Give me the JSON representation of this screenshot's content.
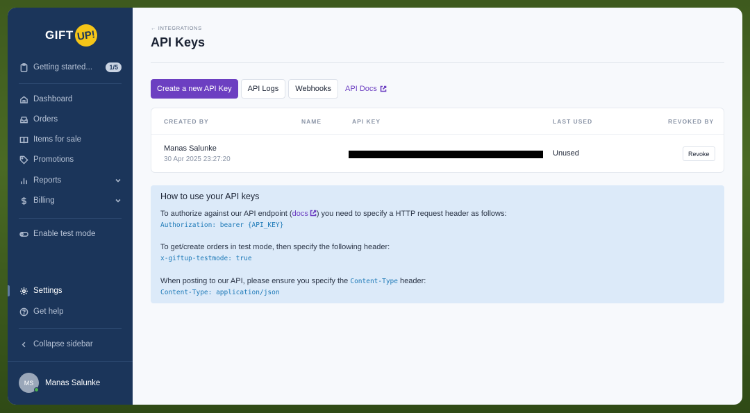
{
  "app": {
    "logo_text": "GIFT",
    "logo_badge": "UP!"
  },
  "sidebar": {
    "getting_started": {
      "label": "Getting started...",
      "badge": "1/5"
    },
    "items": [
      {
        "label": "Dashboard",
        "icon": "home-icon"
      },
      {
        "label": "Orders",
        "icon": "inbox-icon"
      },
      {
        "label": "Items for sale",
        "icon": "book-icon"
      },
      {
        "label": "Promotions",
        "icon": "tag-icon"
      },
      {
        "label": "Reports",
        "icon": "bar-chart-icon",
        "expandable": true
      },
      {
        "label": "Billing",
        "icon": "dollar-icon",
        "expandable": true
      }
    ],
    "test_mode": {
      "label": "Enable test mode",
      "icon": "toggle-icon"
    },
    "settings": {
      "label": "Settings",
      "icon": "gear-icon",
      "active": true
    },
    "help": {
      "label": "Get help",
      "icon": "help-circle-icon"
    },
    "collapse": {
      "label": "Collapse sidebar",
      "icon": "chevron-left-icon"
    },
    "user": {
      "initials": "MS",
      "name": "Manas Salunke"
    }
  },
  "header": {
    "breadcrumb": "← INTEGRATIONS",
    "title": "API Keys"
  },
  "toolbar": {
    "create_label": "Create a new API Key",
    "logs_label": "API Logs",
    "webhooks_label": "Webhooks",
    "docs_label": "API Docs"
  },
  "table": {
    "columns": [
      "CREATED BY",
      "NAME",
      "API KEY",
      "LAST USED",
      "REVOKED BY"
    ],
    "rows": [
      {
        "created_by": "Manas Salunke",
        "created_at": "30 Apr 2025 23:27:20",
        "name": "",
        "last_used": "Unused",
        "action": "Revoke"
      }
    ]
  },
  "help": {
    "title": "How to use your API keys",
    "p1_before": "To authorize against our API endpoint (",
    "p1_link": "docs",
    "p1_after": ") you need to specify a HTTP request header as follows:",
    "p1_code": "Authorization: bearer {API_KEY}",
    "p2": "To get/create orders in test mode, then specify the following header:",
    "p2_code": "x-giftup-testmode: true",
    "p3_before": "When posting to our API, please ensure you specify the ",
    "p3_code_inline": "Content-Type",
    "p3_after": " header:",
    "p3_code": "Content-Type: application/json"
  }
}
